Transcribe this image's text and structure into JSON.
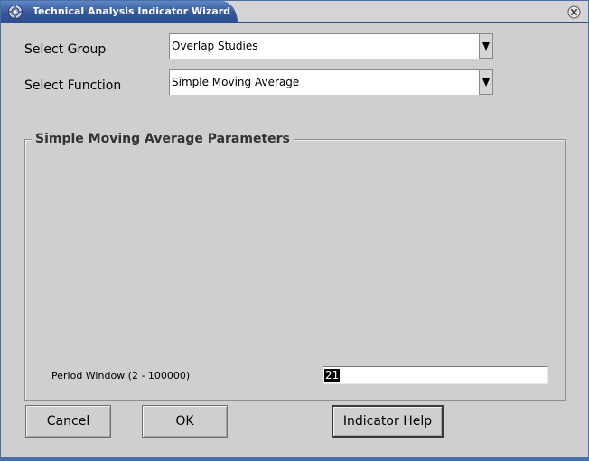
{
  "window": {
    "title": "Technical Analysis Indicator Wizard",
    "icons": {
      "app": "gear-icon",
      "close": "close-icon"
    },
    "accent_color": "#34579a"
  },
  "form": {
    "group_label": "Select Group",
    "group_value": "Overlap Studies",
    "function_label": "Select Function",
    "function_value": "Simple Moving Average"
  },
  "params": {
    "legend": "Simple Moving Average Parameters",
    "period_label": "Period Window (2 - 100000)",
    "period_value": "21"
  },
  "buttons": {
    "cancel": "Cancel",
    "ok": "OK",
    "help": "Indicator Help"
  }
}
